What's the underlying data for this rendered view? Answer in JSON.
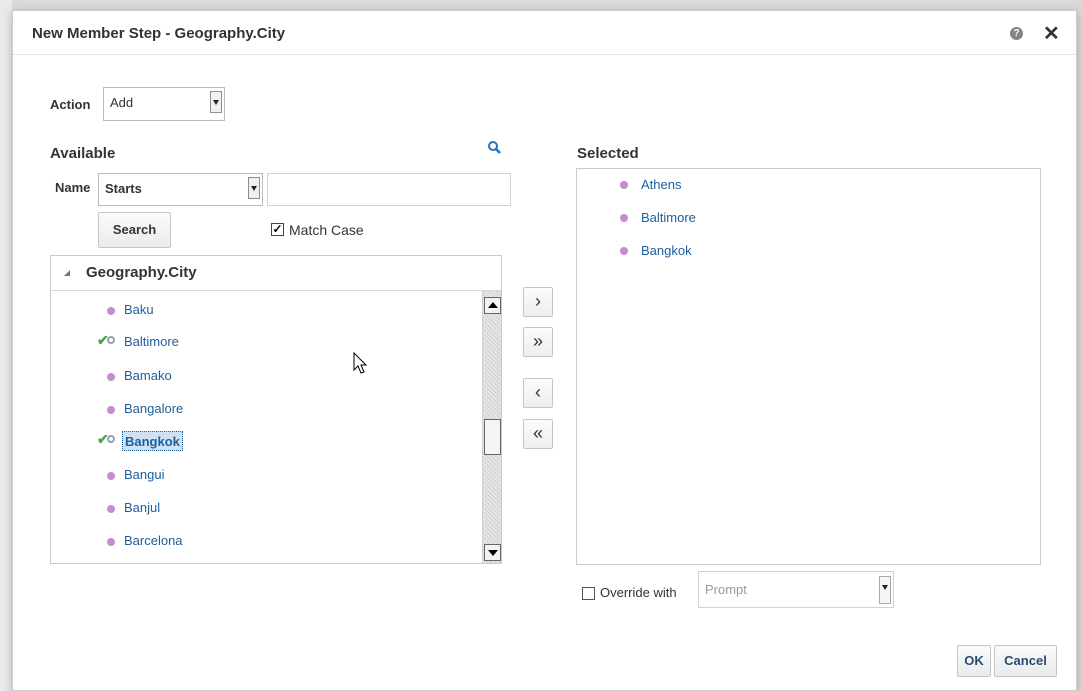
{
  "dialog": {
    "title": "New Member Step - Geography.City",
    "help_icon": "help-icon",
    "close_icon": "close-icon",
    "close_glyph": "✕"
  },
  "action": {
    "label": "Action",
    "value": "Add"
  },
  "available": {
    "heading": "Available",
    "search_icon": "magnifier-icon",
    "name_label": "Name",
    "name_operator": "Starts",
    "name_value": "",
    "search_button": "Search",
    "match_case_label": "Match Case",
    "match_case_checked": true,
    "tree_title": "Geography.City",
    "items": [
      {
        "label": "Baku",
        "selected": false
      },
      {
        "label": "Baltimore",
        "selected": true
      },
      {
        "label": "Bamako",
        "selected": false
      },
      {
        "label": "Bangalore",
        "selected": false
      },
      {
        "label": "Bangkok",
        "selected": true,
        "highlighted": true
      },
      {
        "label": "Bangui",
        "selected": false
      },
      {
        "label": "Banjul",
        "selected": false
      },
      {
        "label": "Barcelona",
        "selected": false
      }
    ]
  },
  "shuttle": {
    "move": "›",
    "move_all": "»",
    "remove": "‹",
    "remove_all": "«"
  },
  "selected": {
    "heading": "Selected",
    "items": [
      "Athens",
      "Baltimore",
      "Bangkok"
    ]
  },
  "override": {
    "label": "Override with",
    "checked": false,
    "value": "Prompt"
  },
  "buttons": {
    "ok": "OK",
    "cancel": "Cancel"
  },
  "colors": {
    "link": "#1d5f9b",
    "member_dot": "#c68bd0",
    "check": "#4aa44a",
    "highlight": "#cfe2f5"
  }
}
